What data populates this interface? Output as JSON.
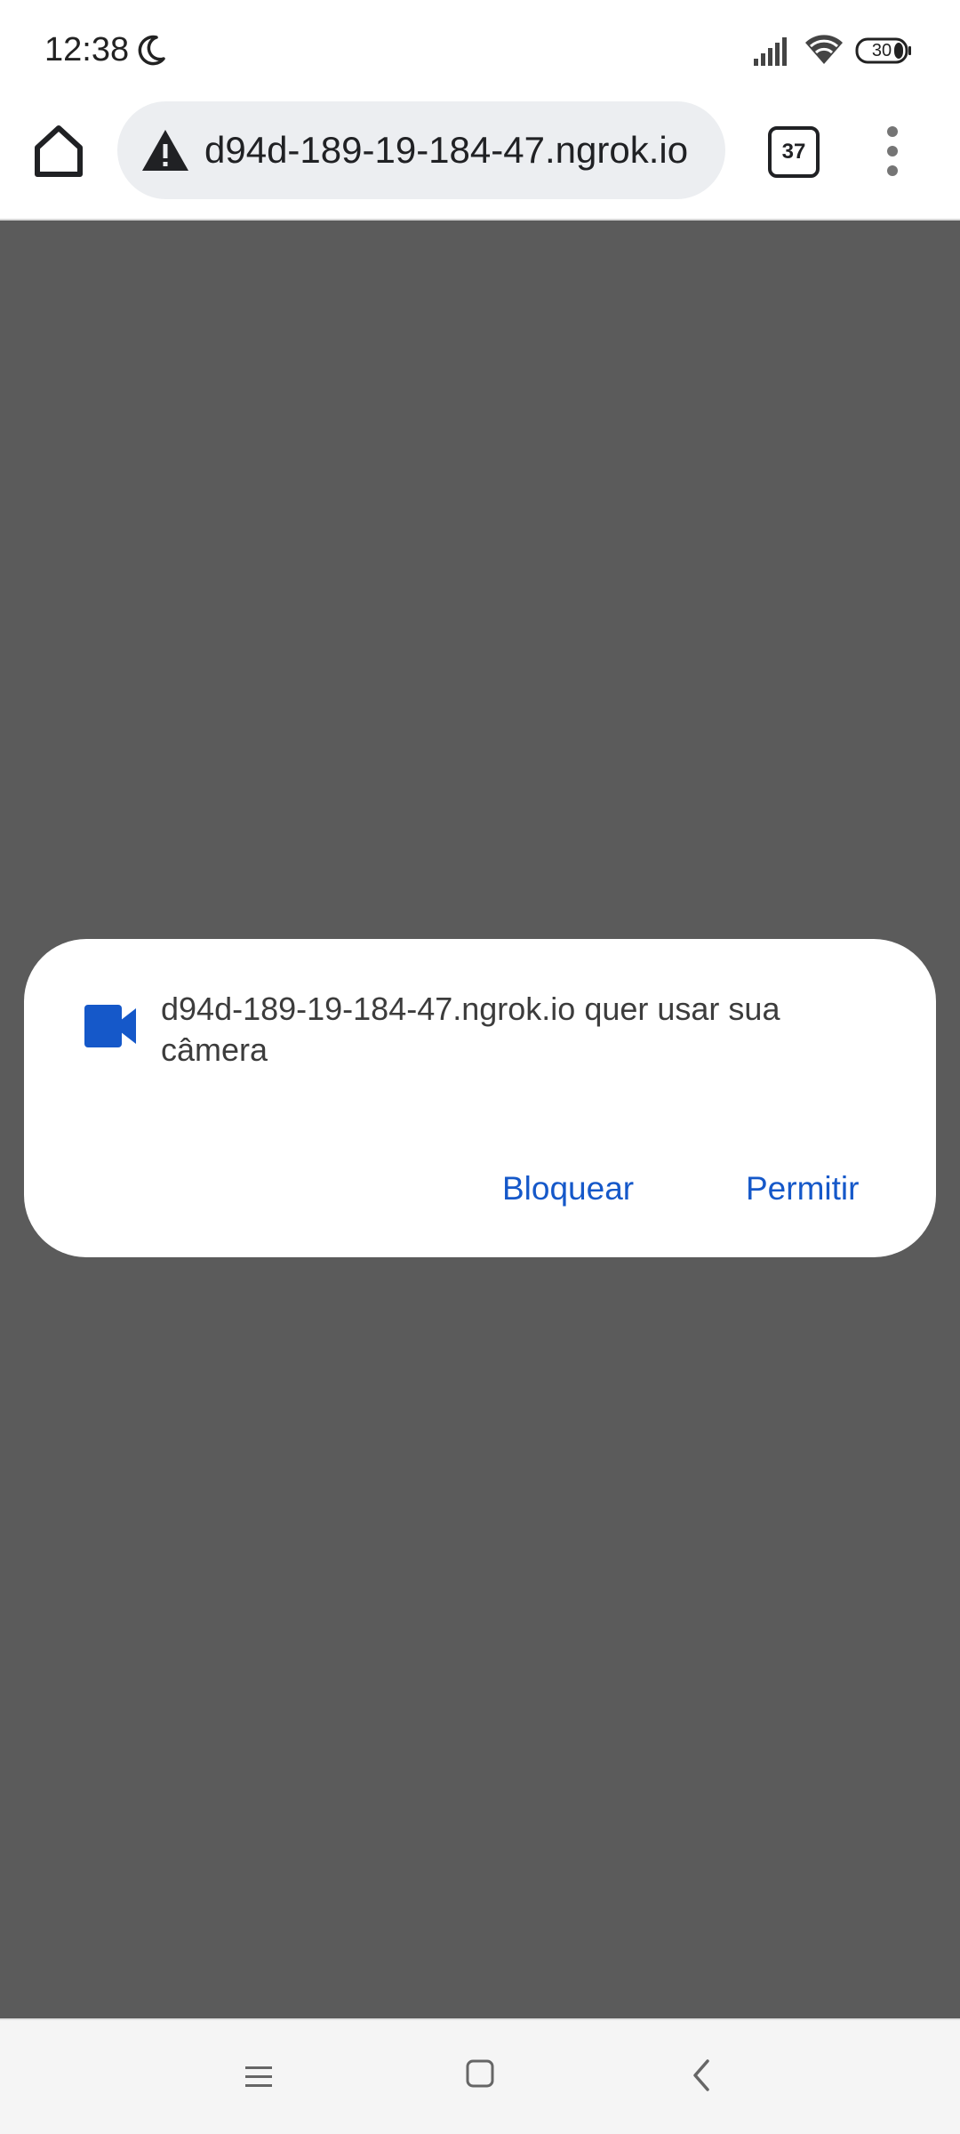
{
  "status_bar": {
    "time": "12:38",
    "battery_level": "30",
    "icons": [
      "moon-icon",
      "signal-icon",
      "wifi-icon",
      "battery-icon"
    ]
  },
  "toolbar": {
    "url": "d94d-189-19-184-47.ngrok.io",
    "tabs_count": "37",
    "icons": [
      "home-icon",
      "warning-icon",
      "tabs-icon",
      "more-vert-icon"
    ]
  },
  "dialog": {
    "message": "d94d-189-19-184-47.ngrok.io quer usar sua câmera",
    "icon": "videocam-icon",
    "block_label": "Bloquear",
    "allow_label": "Permitir"
  },
  "nav_bar": {
    "icons": [
      "menu-icon",
      "square-home-icon",
      "back-chevron-icon"
    ]
  },
  "colors": {
    "accent": "#1558c9",
    "scrim": "#5b5b5b",
    "url_pill": "#eceef1"
  }
}
